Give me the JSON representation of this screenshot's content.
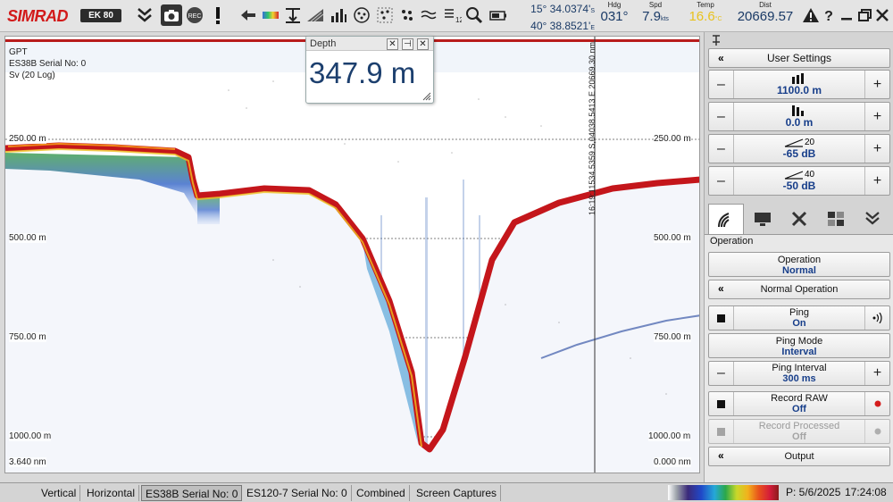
{
  "topbar": {
    "brand": "SIMRAD",
    "model": "EK 80",
    "position": {
      "lat": "15° 34.0374'",
      "lat_hemi": "S",
      "lon": "40° 38.8521'",
      "lon_hemi": "E"
    },
    "heading": {
      "label": "Hdg",
      "value": "031°"
    },
    "speed": {
      "label": "Spd",
      "value": "7.9",
      "unit": "kts"
    },
    "temp": {
      "label": "Temp",
      "value": "16.6",
      "unit": "°C"
    },
    "dist": {
      "label": "Dist",
      "value": "20669.57"
    },
    "icons": [
      "chevron-down-icon",
      "camera-icon",
      "record-icon",
      "alert-icon",
      "arrow-left-icon",
      "color-scale-icon",
      "depth-range-icon",
      "bottom-hatch-icon",
      "bar-chart-icon",
      "target-icon",
      "scatter-icon",
      "waves-icon",
      "layer-icon",
      "zoom-icon",
      "battery-icon"
    ]
  },
  "echogram": {
    "info": [
      "GPT",
      "ES38B Serial No: 0",
      "Sv (20 Log)"
    ],
    "grid_labels_left": [
      "250.00 m",
      "500.00 m",
      "750.00 m",
      "1000.00 m"
    ],
    "grid_labels_right": [
      "250.00 m",
      "500.00 m",
      "750.00 m",
      "1000.00 m"
    ],
    "top_depth": "3.640 nm",
    "right_bottom": "0.000 nm",
    "vertical_marker": "16:19:11534.5359 S,04038.5413 E 20669.30 nm"
  },
  "depth_popup": {
    "title": "Depth",
    "value": "347.9 m"
  },
  "panel": {
    "user_settings": "User Settings",
    "range": "1100.0 m",
    "start": "0.0 m",
    "gain1": {
      "value": "-65 dB",
      "tag": "20"
    },
    "gain2": {
      "value": "-50 dB",
      "tag": "40"
    },
    "section": "Operation",
    "operation": {
      "label": "Operation",
      "value": "Normal"
    },
    "normal_operation": "Normal Operation",
    "ping": {
      "label": "Ping",
      "value": "On"
    },
    "ping_mode": {
      "label": "Ping Mode",
      "value": "Interval"
    },
    "ping_interval": {
      "label": "Ping Interval",
      "value": "300 ms"
    },
    "record_raw": {
      "label": "Record RAW",
      "value": "Off"
    },
    "record_processed": {
      "label": "Record Processed",
      "value": "Off"
    },
    "output": "Output"
  },
  "status": {
    "tabs": [
      "Vertical",
      "Horizontal",
      "ES38B Serial No: 0",
      "ES120-7 Serial No: 0",
      "Combined",
      "Screen Captures"
    ],
    "selected_tab": 2,
    "date": "P: 5/6/2025",
    "time": "17:24:08"
  },
  "colors": {
    "accent_blue": "#173e8a",
    "brand_red": "#d21a1a",
    "echo_red": "#c4161b"
  }
}
